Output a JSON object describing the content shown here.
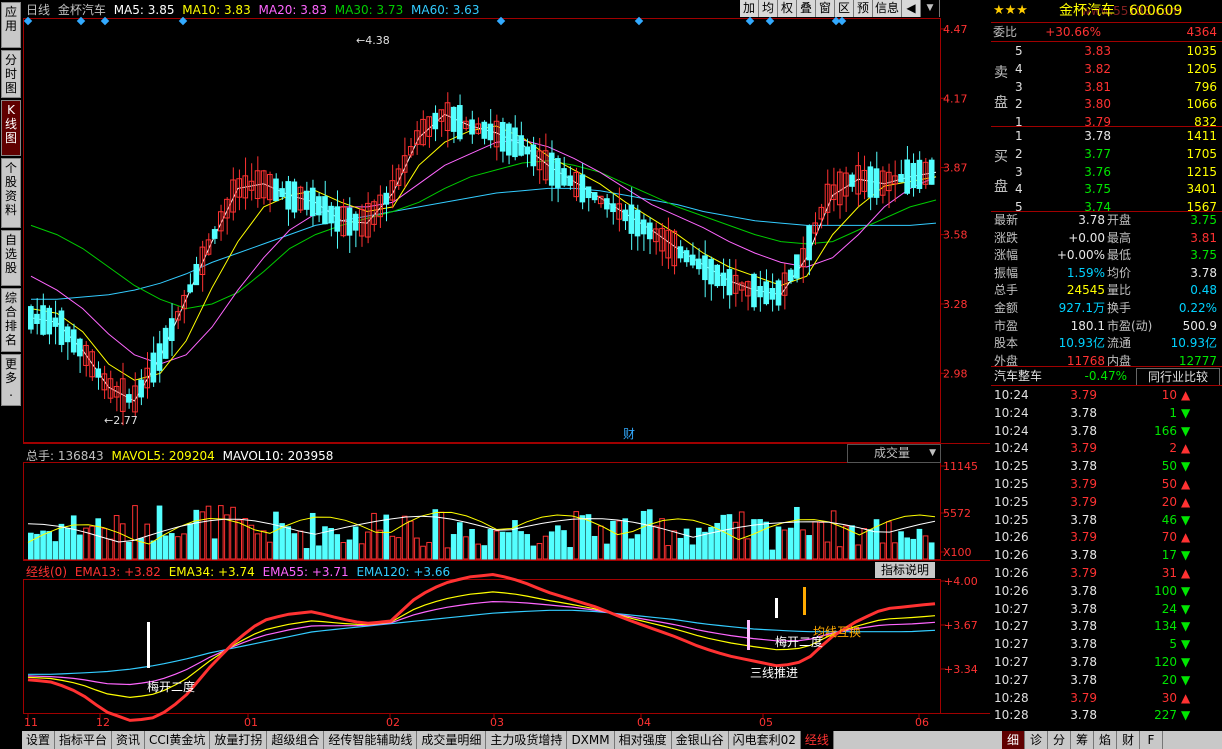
{
  "left_tabs": [
    {
      "label": "应用",
      "active": false
    },
    {
      "label": "分时图",
      "active": false
    },
    {
      "label": "K线图",
      "active": true
    },
    {
      "label": "个股资料",
      "active": false
    },
    {
      "label": "自选股",
      "active": false
    },
    {
      "label": "综合排名",
      "active": false
    },
    {
      "label": "更多..",
      "active": false
    }
  ],
  "toolbar": [
    "加",
    "均",
    "权",
    "叠",
    "窗",
    "区",
    "预",
    "信息"
  ],
  "header": {
    "period": "日线",
    "name": "金杯汽车",
    "ma5": "MA5: 3.85",
    "ma10": "MA10: 3.83",
    "ma20": "MA20: 3.83",
    "ma30": "MA30: 3.73",
    "ma60": "MA60: 3.63"
  },
  "price_axis": [
    "4.47",
    "4.17",
    "3.87",
    "3.58",
    "3.28",
    "2.98"
  ],
  "annotations": {
    "high": "4.38",
    "low": "2.77",
    "cai": "财"
  },
  "volume": {
    "header": "总手: 136843",
    "mavol5": "MAVOL5: 209204",
    "mavol10": "MAVOL10: 203958",
    "selector": "成交量",
    "axis": [
      "11145",
      "5572",
      "X100"
    ]
  },
  "indicator": {
    "name": "经线(0)",
    "ema13": "EMA13: +3.82",
    "ema34": "EMA34: +3.74",
    "ema55": "EMA55: +3.71",
    "ema120": "EMA120: +3.66",
    "button": "指标说明",
    "axis": [
      "+4.00",
      "+3.67",
      "+3.34"
    ],
    "labels": [
      "梅开二度",
      "三线推进",
      "梅开二度",
      "均线互换"
    ]
  },
  "x_axis": [
    "11",
    "12",
    "01",
    "02",
    "03",
    "04",
    "05",
    "06"
  ],
  "bottom_tabs": [
    "设置",
    "指标平台",
    "资讯",
    "CCI黄金坑",
    "放量打拐",
    "超级组合",
    "经传智能辅助线",
    "成交量明细",
    "主力吸货增持",
    "DXMM",
    "相对强度",
    "金银山谷",
    "闪电套利02",
    "经线"
  ],
  "right_bottom_tabs": [
    "细",
    "诊",
    "分",
    "筹",
    "焰",
    "财",
    "F"
  ],
  "quote": {
    "stars": "★★★",
    "name": "金杯汽车",
    "code": "600609",
    "watermark": "www.55188.com",
    "weibi_label": "委比",
    "weibi": "+30.66%",
    "weicha": "4364",
    "sell_label": [
      "卖",
      "盘"
    ],
    "buy_label": [
      "买",
      "盘"
    ],
    "sells": [
      {
        "lv": "5",
        "p": "3.83",
        "v": "1035"
      },
      {
        "lv": "4",
        "p": "3.82",
        "v": "1205"
      },
      {
        "lv": "3",
        "p": "3.81",
        "v": "796"
      },
      {
        "lv": "2",
        "p": "3.80",
        "v": "1066"
      },
      {
        "lv": "1",
        "p": "3.79",
        "v": "832"
      }
    ],
    "buys": [
      {
        "lv": "1",
        "p": "3.78",
        "v": "1411"
      },
      {
        "lv": "2",
        "p": "3.77",
        "v": "1705"
      },
      {
        "lv": "3",
        "p": "3.76",
        "v": "1215"
      },
      {
        "lv": "4",
        "p": "3.75",
        "v": "3401"
      },
      {
        "lv": "5",
        "p": "3.74",
        "v": "1567"
      }
    ],
    "stats": [
      {
        "l1": "最新",
        "v1": "3.78",
        "c1": "w",
        "l2": "开盘",
        "v2": "3.75",
        "c2": "g"
      },
      {
        "l1": "涨跌",
        "v1": "+0.00",
        "c1": "w",
        "l2": "最高",
        "v2": "3.81",
        "c2": "r"
      },
      {
        "l1": "涨幅",
        "v1": "+0.00%",
        "c1": "w",
        "l2": "最低",
        "v2": "3.75",
        "c2": "g"
      },
      {
        "l1": "振幅",
        "v1": "1.59%",
        "c1": "c",
        "l2": "均价",
        "v2": "3.78",
        "c2": "w"
      },
      {
        "l1": "总手",
        "v1": "24545",
        "c1": "y",
        "l2": "量比",
        "v2": "0.48",
        "c2": "c"
      },
      {
        "l1": "金额",
        "v1": "927.1万",
        "c1": "c",
        "l2": "换手",
        "v2": "0.22%",
        "c2": "c"
      },
      {
        "l1": "市盈",
        "v1": "180.1",
        "c1": "w",
        "l2": "市盈(动)",
        "v2": "500.9",
        "c2": "w"
      },
      {
        "l1": "股本",
        "v1": "10.93亿",
        "c1": "c",
        "l2": "流通",
        "v2": "10.93亿",
        "c2": "c"
      },
      {
        "l1": "外盘",
        "v1": "11768",
        "c1": "r",
        "l2": "内盘",
        "v2": "12777",
        "c2": "g"
      }
    ],
    "sector": "汽车整车",
    "sector_change": "-0.47%",
    "compare": "同行业比较",
    "ticks": [
      {
        "t": "10:24",
        "p": "3.79",
        "v": "10",
        "d": "up"
      },
      {
        "t": "10:24",
        "p": "3.78",
        "v": "1",
        "d": "down"
      },
      {
        "t": "10:24",
        "p": "3.78",
        "v": "166",
        "d": "down"
      },
      {
        "t": "10:24",
        "p": "3.79",
        "v": "2",
        "d": "up"
      },
      {
        "t": "10:25",
        "p": "3.78",
        "v": "50",
        "d": "down"
      },
      {
        "t": "10:25",
        "p": "3.79",
        "v": "50",
        "d": "up"
      },
      {
        "t": "10:25",
        "p": "3.79",
        "v": "20",
        "d": "up"
      },
      {
        "t": "10:25",
        "p": "3.78",
        "v": "46",
        "d": "down"
      },
      {
        "t": "10:26",
        "p": "3.79",
        "v": "70",
        "d": "up"
      },
      {
        "t": "10:26",
        "p": "3.78",
        "v": "17",
        "d": "down"
      },
      {
        "t": "10:26",
        "p": "3.79",
        "v": "31",
        "d": "up"
      },
      {
        "t": "10:26",
        "p": "3.78",
        "v": "100",
        "d": "down"
      },
      {
        "t": "10:27",
        "p": "3.78",
        "v": "24",
        "d": "down"
      },
      {
        "t": "10:27",
        "p": "3.78",
        "v": "134",
        "d": "down"
      },
      {
        "t": "10:27",
        "p": "3.78",
        "v": "5",
        "d": "down"
      },
      {
        "t": "10:27",
        "p": "3.78",
        "v": "120",
        "d": "down"
      },
      {
        "t": "10:27",
        "p": "3.78",
        "v": "20",
        "d": "down"
      },
      {
        "t": "10:28",
        "p": "3.79",
        "v": "30",
        "d": "up"
      },
      {
        "t": "10:28",
        "p": "3.78",
        "v": "227",
        "d": "down"
      }
    ]
  },
  "colors": {
    "up": "#ff3232",
    "down": "#54ffff",
    "ma5": "#ffffff",
    "ma10": "#ffff00",
    "ma20": "#ff66ff",
    "ma30": "#00cc00",
    "ma60": "#33ccff",
    "border": "#a00000"
  },
  "chart_data": {
    "type": "candlestick",
    "ylim": [
      2.7,
      4.5
    ],
    "price_ticks": [
      4.47,
      4.17,
      3.87,
      3.58,
      3.28,
      2.98
    ],
    "candles": [],
    "ma5": [
      3.22,
      3.2,
      3.08,
      2.92,
      2.86,
      3.05,
      3.3,
      3.55,
      3.78,
      3.8,
      3.75,
      3.72,
      3.64,
      3.63,
      3.76,
      4.0,
      4.1,
      4.05,
      4.02,
      3.97,
      3.88,
      3.81,
      3.74,
      3.67,
      3.6,
      3.52,
      3.45,
      3.38,
      3.34,
      3.32,
      3.48,
      3.75,
      3.82,
      3.8,
      3.83,
      3.85
    ],
    "ma10": [
      3.26,
      3.24,
      3.16,
      3.02,
      2.95,
      2.98,
      3.12,
      3.35,
      3.55,
      3.7,
      3.75,
      3.77,
      3.72,
      3.68,
      3.7,
      3.88,
      3.98,
      4.03,
      4.05,
      4.0,
      3.92,
      3.86,
      3.8,
      3.72,
      3.65,
      3.58,
      3.5,
      3.44,
      3.4,
      3.36,
      3.4,
      3.58,
      3.7,
      3.79,
      3.81,
      3.83
    ],
    "ma20": [
      3.4,
      3.34,
      3.26,
      3.15,
      3.06,
      3.02,
      3.06,
      3.18,
      3.34,
      3.48,
      3.6,
      3.67,
      3.7,
      3.7,
      3.72,
      3.8,
      3.88,
      3.93,
      3.98,
      3.99,
      3.96,
      3.91,
      3.85,
      3.78,
      3.71,
      3.66,
      3.61,
      3.55,
      3.5,
      3.46,
      3.44,
      3.48,
      3.58,
      3.7,
      3.78,
      3.83
    ],
    "ma30": [
      3.62,
      3.58,
      3.52,
      3.44,
      3.36,
      3.3,
      3.26,
      3.28,
      3.33,
      3.42,
      3.52,
      3.58,
      3.62,
      3.65,
      3.68,
      3.72,
      3.78,
      3.83,
      3.86,
      3.89,
      3.9,
      3.88,
      3.85,
      3.8,
      3.75,
      3.7,
      3.66,
      3.62,
      3.58,
      3.55,
      3.54,
      3.55,
      3.6,
      3.65,
      3.7,
      3.73
    ],
    "ma60": [
      3.3,
      3.3,
      3.31,
      3.32,
      3.34,
      3.37,
      3.41,
      3.46,
      3.5,
      3.54,
      3.58,
      3.62,
      3.64,
      3.66,
      3.68,
      3.7,
      3.72,
      3.74,
      3.76,
      3.77,
      3.78,
      3.78,
      3.77,
      3.75,
      3.73,
      3.71,
      3.68,
      3.66,
      3.64,
      3.63,
      3.62,
      3.62,
      3.62,
      3.62,
      3.62,
      3.63
    ]
  }
}
